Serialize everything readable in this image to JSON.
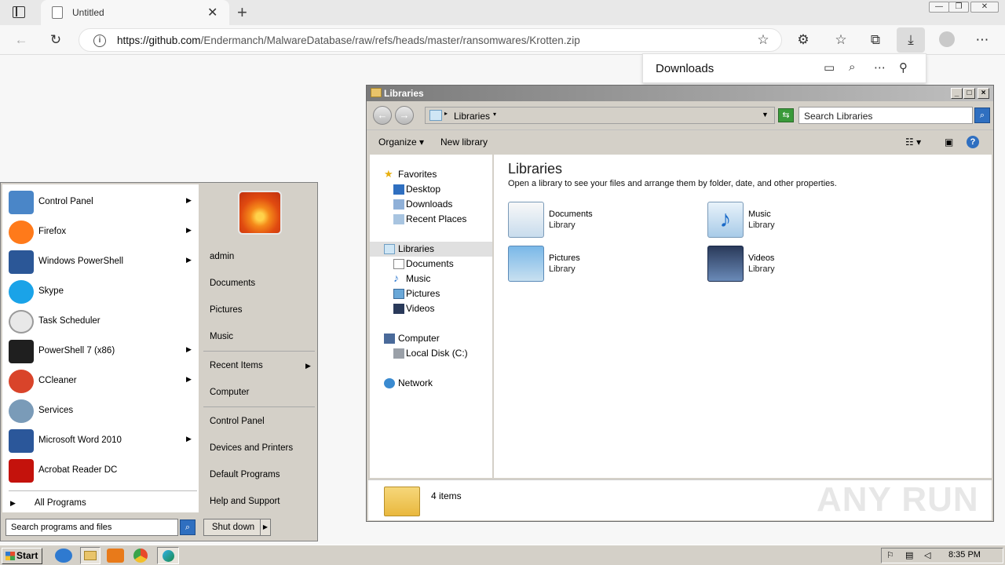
{
  "browser": {
    "tab_title": "Untitled",
    "url_domain": "https://github.com",
    "url_path": "/Endermanch/MalwareDatabase/raw/refs/heads/master/ransomwares/Krotten.zip",
    "downloads_title": "Downloads"
  },
  "explorer": {
    "window_title": "Libraries",
    "breadcrumb": "Libraries",
    "search_placeholder": "Search Libraries",
    "toolbar": {
      "organize": "Organize",
      "new_library": "New library"
    },
    "nav": {
      "favorites": "Favorites",
      "desktop": "Desktop",
      "downloads": "Downloads",
      "recent_places": "Recent Places",
      "libraries": "Libraries",
      "documents": "Documents",
      "music": "Music",
      "pictures": "Pictures",
      "videos": "Videos",
      "computer": "Computer",
      "local_disk": "Local Disk (C:)",
      "network": "Network"
    },
    "heading": "Libraries",
    "description": "Open a library to see your files and arrange them by folder, date, and other properties.",
    "libraries": [
      {
        "name": "Documents",
        "sub": "Library"
      },
      {
        "name": "Music",
        "sub": "Library"
      },
      {
        "name": "Pictures",
        "sub": "Library"
      },
      {
        "name": "Videos",
        "sub": "Library"
      }
    ],
    "status": "4 items"
  },
  "start_menu": {
    "programs": [
      {
        "label": "Control Panel",
        "color": "#4a86c8"
      },
      {
        "label": "Firefox",
        "color": "#ff7a1a"
      },
      {
        "label": "Windows PowerShell",
        "color": "#2b5797"
      },
      {
        "label": "Skype",
        "color": "#1aa3e8"
      },
      {
        "label": "Task Scheduler",
        "color": "#b0b0b0"
      },
      {
        "label": "PowerShell 7 (x86)",
        "color": "#1f1f1f"
      },
      {
        "label": "CCleaner",
        "color": "#d9442a"
      },
      {
        "label": "Services",
        "color": "#7a9bb8"
      },
      {
        "label": "Microsoft Word 2010",
        "color": "#2b579a"
      },
      {
        "label": "Acrobat Reader DC",
        "color": "#c4120c"
      }
    ],
    "all_programs": "All Programs",
    "search_placeholder": "Search programs and files",
    "right": {
      "user": "admin",
      "documents": "Documents",
      "pictures": "Pictures",
      "music": "Music",
      "recent_items": "Recent Items",
      "computer": "Computer",
      "control_panel": "Control Panel",
      "devices_printers": "Devices and Printers",
      "default_programs": "Default Programs",
      "help_support": "Help and Support"
    },
    "shutdown": "Shut down"
  },
  "taskbar": {
    "start": "Start",
    "clock": "8:35 PM"
  },
  "watermark": "ANY RUN"
}
